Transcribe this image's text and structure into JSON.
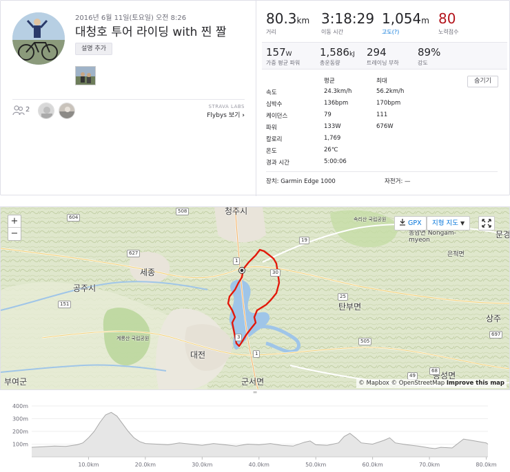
{
  "activity": {
    "date": "2016년 6월 11일(토요일) 오전 8:26",
    "title": "대청호 투어 라이딩 with 찐 짤",
    "add_description": "설명 추가",
    "kudos_count": "2",
    "strava_labs": "STRAVA LABS",
    "flybys": "Flybys 보기"
  },
  "stats": {
    "distance": {
      "value": "80.3",
      "unit": "km",
      "label": "거리"
    },
    "moving_time": {
      "value": "3:18:29",
      "label": "이동 시간"
    },
    "elevation": {
      "value": "1,054",
      "unit": "m",
      "label": "고도(?)"
    },
    "suffer": {
      "value": "80",
      "label": "노력점수",
      "color": "#b3131b"
    },
    "weighted_power": {
      "value": "157",
      "unit": "W",
      "label": "가중 평균 파워"
    },
    "total_work": {
      "value": "1,586",
      "unit": "kJ",
      "label": "총운동량"
    },
    "training_load": {
      "value": "294",
      "label": "트레이닝 부하"
    },
    "intensity": {
      "value": "89%",
      "label": "강도"
    }
  },
  "details": {
    "more_button": "숨기기",
    "col_avg": "평균",
    "col_max": "최대",
    "rows": [
      {
        "label": "속도",
        "avg": "24.3km/h",
        "max": "56.2km/h"
      },
      {
        "label": "심박수",
        "avg": "136bpm",
        "max": "170bpm"
      },
      {
        "label": "케이던스",
        "avg": "79",
        "max": "111"
      },
      {
        "label": "파워",
        "avg": "133W",
        "max": "676W"
      },
      {
        "label": "칼로리",
        "avg": "1,769",
        "max": ""
      },
      {
        "label": "온도",
        "avg": "26℃",
        "max": ""
      },
      {
        "label": "경과 시간",
        "avg": "5:00:06",
        "max": ""
      }
    ],
    "device": "장치: Garmin Edge 1000",
    "bike": "자전거: —"
  },
  "map": {
    "zoom_in": "+",
    "zoom_out": "−",
    "gpx_button": "GPX",
    "map_type_button": "지형 지도",
    "attribution_mapbox": "© Mapbox",
    "attribution_osm": "© OpenStreetMap",
    "attribution_improve": "Improve this map",
    "place_labels": {
      "sejong": "세종",
      "gongju": "공주시",
      "daejeon": "대전",
      "cheongju": "청주시",
      "buyeo": "부여군",
      "tanbu": "탄부면",
      "sangju": "상주",
      "gunseo": "군서면",
      "gongseong": "공성면",
      "eunchuk": "은척면",
      "nongam": "농암면 Nongam-myeon",
      "mungyeong": "문경",
      "gyeryong": "계룡산 국립공원",
      "songnisan": "속리산 국립공원"
    },
    "road_shields": [
      "604",
      "508",
      "627",
      "19",
      "30",
      "1",
      "151",
      "25",
      "505",
      "697",
      "49",
      "68",
      "3",
      "1"
    ],
    "route_color": "#e3180a"
  },
  "elevation_chart": {
    "y_ticks": [
      "400m",
      "300m",
      "200m",
      "100m"
    ],
    "x_ticks": [
      "10.0km",
      "20.0km",
      "30.0km",
      "40.0km",
      "50.0km",
      "60.0km",
      "70.0km",
      "80.0km"
    ],
    "ylim": [
      0,
      400
    ],
    "xlim": [
      0,
      80.3
    ],
    "profile_km": [
      0,
      2,
      4,
      6,
      8,
      9,
      10,
      11,
      12,
      13,
      14,
      15,
      16,
      17,
      18,
      19,
      20,
      22,
      24,
      26,
      28,
      30,
      32,
      34,
      36,
      38,
      40,
      42,
      44,
      46,
      48,
      49,
      50,
      52,
      54,
      55,
      56,
      57,
      58,
      60,
      62,
      63,
      64,
      66,
      68,
      70,
      71,
      72,
      74,
      76,
      78,
      80,
      80.3
    ],
    "profile_m": [
      75,
      80,
      85,
      82,
      95,
      110,
      150,
      200,
      270,
      330,
      350,
      320,
      260,
      200,
      150,
      120,
      105,
      100,
      95,
      110,
      100,
      90,
      105,
      95,
      85,
      100,
      95,
      105,
      90,
      85,
      115,
      125,
      95,
      90,
      110,
      160,
      185,
      150,
      110,
      100,
      130,
      150,
      110,
      95,
      85,
      70,
      65,
      75,
      70,
      140,
      125,
      110,
      100
    ],
    "fill_color": "#e6e6e6",
    "line_color": "#a8a8a8"
  }
}
